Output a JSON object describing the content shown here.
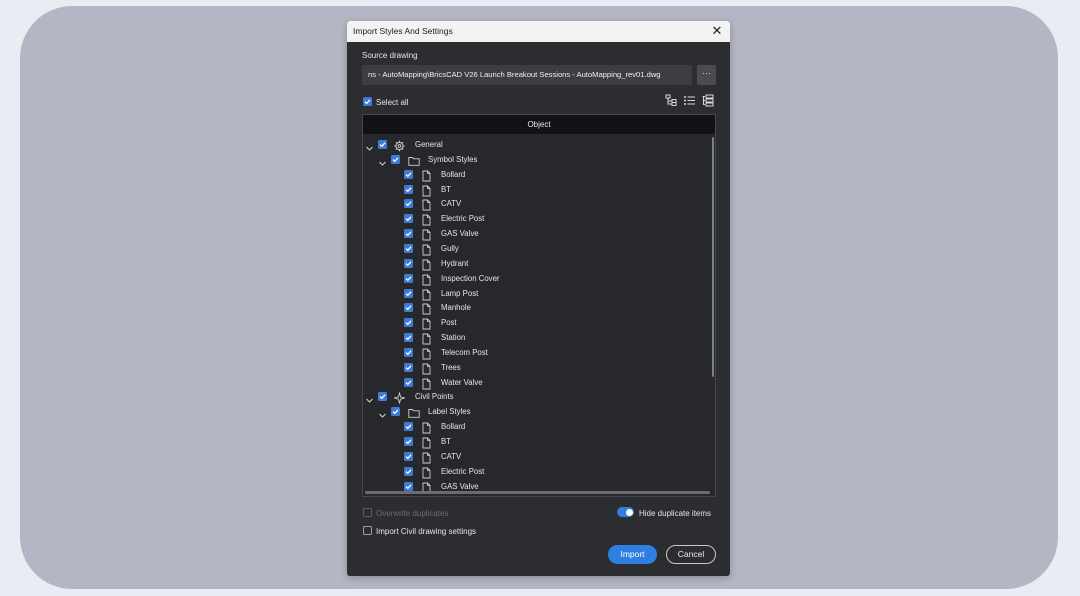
{
  "dialog": {
    "title": "Import Styles And Settings",
    "source_label": "Source drawing",
    "source_value": "ns - AutoMapping\\BricsCAD V26 Launch Breakout Sessions - AutoMapping_rev01.dwg",
    "browse_label": "···",
    "select_all_label": "Select all",
    "select_all_checked": true,
    "column_header": "Object",
    "overwrite_label": "Overwrite duplicates",
    "overwrite_checked": false,
    "overwrite_enabled": false,
    "hide_duplicates_label": "Hide duplicate items",
    "hide_duplicates_on": true,
    "import_civil_label": "Import Civil drawing settings",
    "import_civil_checked": false,
    "import_button": "Import",
    "cancel_button": "Cancel"
  },
  "tree": [
    {
      "label": "General",
      "level": 0,
      "icon": "gear-icon",
      "expanded": true,
      "checked": true
    },
    {
      "label": "Symbol Styles",
      "level": 1,
      "icon": "folder-icon",
      "expanded": true,
      "checked": true
    },
    {
      "label": "Bollard",
      "level": 2,
      "icon": "file-icon",
      "checked": true
    },
    {
      "label": "BT",
      "level": 2,
      "icon": "file-icon",
      "checked": true
    },
    {
      "label": "CATV",
      "level": 2,
      "icon": "file-icon",
      "checked": true
    },
    {
      "label": "Electric Post",
      "level": 2,
      "icon": "file-icon",
      "checked": true
    },
    {
      "label": "GAS Valve",
      "level": 2,
      "icon": "file-icon",
      "checked": true
    },
    {
      "label": "Gully",
      "level": 2,
      "icon": "file-icon",
      "checked": true
    },
    {
      "label": "Hydrant",
      "level": 2,
      "icon": "file-icon",
      "checked": true
    },
    {
      "label": "Inspection Cover",
      "level": 2,
      "icon": "file-icon",
      "checked": true
    },
    {
      "label": "Lamp Post",
      "level": 2,
      "icon": "file-icon",
      "checked": true
    },
    {
      "label": "Manhole",
      "level": 2,
      "icon": "file-icon",
      "checked": true
    },
    {
      "label": "Post",
      "level": 2,
      "icon": "file-icon",
      "checked": true
    },
    {
      "label": "Station",
      "level": 2,
      "icon": "file-icon",
      "checked": true
    },
    {
      "label": "Telecom Post",
      "level": 2,
      "icon": "file-icon",
      "checked": true
    },
    {
      "label": "Trees",
      "level": 2,
      "icon": "file-icon",
      "checked": true
    },
    {
      "label": "Water Valve",
      "level": 2,
      "icon": "file-icon",
      "checked": true
    },
    {
      "label": "Civil Points",
      "level": 0,
      "icon": "civil-points-icon",
      "expanded": true,
      "checked": true
    },
    {
      "label": "Label Styles",
      "level": 1,
      "icon": "folder-icon",
      "expanded": true,
      "checked": true
    },
    {
      "label": "Bollard",
      "level": 2,
      "icon": "file-icon",
      "checked": true
    },
    {
      "label": "BT",
      "level": 2,
      "icon": "file-icon",
      "checked": true
    },
    {
      "label": "CATV",
      "level": 2,
      "icon": "file-icon",
      "checked": true
    },
    {
      "label": "Electric Post",
      "level": 2,
      "icon": "file-icon",
      "checked": true
    },
    {
      "label": "GAS Valve",
      "level": 2,
      "icon": "file-icon",
      "checked": true
    }
  ],
  "colors": {
    "accent": "#2f7fe0",
    "dialog_bg": "#2b2d31",
    "backdrop": "#b4b7c3"
  }
}
